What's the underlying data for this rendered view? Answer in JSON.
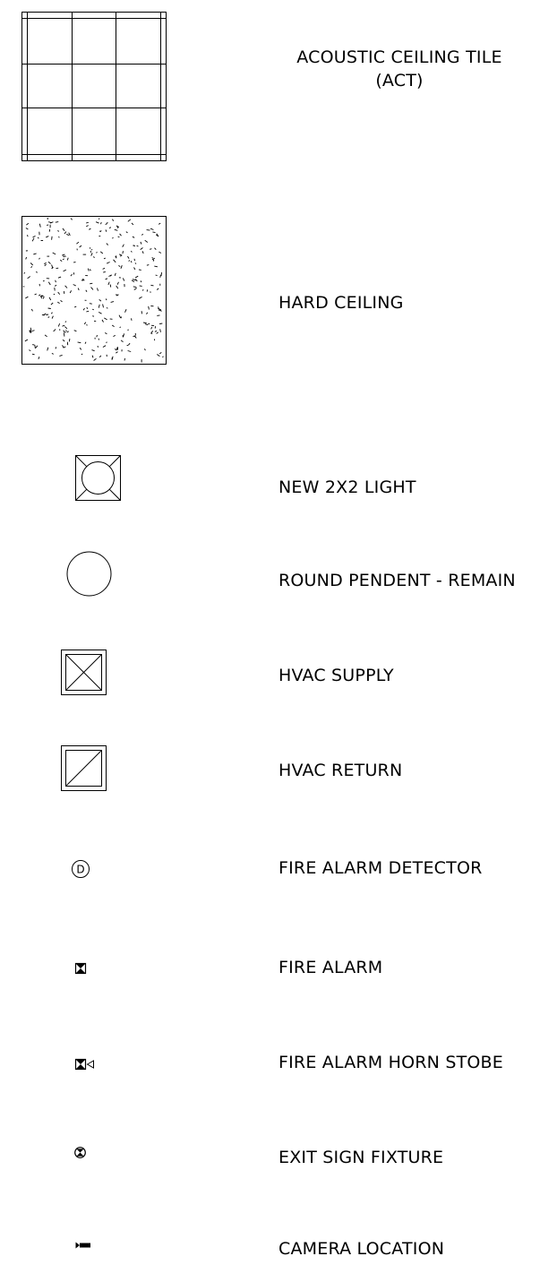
{
  "legend": [
    {
      "id": "act",
      "symbol": "acoustic-ceiling-tile-icon",
      "lines": [
        "ACOUSTIC CEILING TILE",
        "(ACT)"
      ]
    },
    {
      "id": "hard-ceiling",
      "symbol": "hard-ceiling-icon",
      "label": "HARD CEILING"
    },
    {
      "id": "light",
      "symbol": "2x2-light-icon",
      "label": "NEW 2X2 LIGHT"
    },
    {
      "id": "pendent",
      "symbol": "round-pendent-icon",
      "label": "ROUND PENDENT - REMAIN"
    },
    {
      "id": "supply",
      "symbol": "hvac-supply-icon",
      "label": "HVAC SUPPLY"
    },
    {
      "id": "return",
      "symbol": "hvac-return-icon",
      "label": "HVAC RETURN"
    },
    {
      "id": "detector",
      "symbol": "fire-alarm-detector-icon",
      "label": "FIRE ALARM DETECTOR",
      "glyph": "D"
    },
    {
      "id": "alarm",
      "symbol": "fire-alarm-icon",
      "label": "FIRE ALARM"
    },
    {
      "id": "horn",
      "symbol": "fire-alarm-horn-strobe-icon",
      "label": "FIRE ALARM HORN STOBE"
    },
    {
      "id": "exit",
      "symbol": "exit-sign-fixture-icon",
      "label": "EXIT SIGN FIXTURE"
    },
    {
      "id": "camera",
      "symbol": "camera-location-icon",
      "label": "CAMERA LOCATION"
    }
  ]
}
